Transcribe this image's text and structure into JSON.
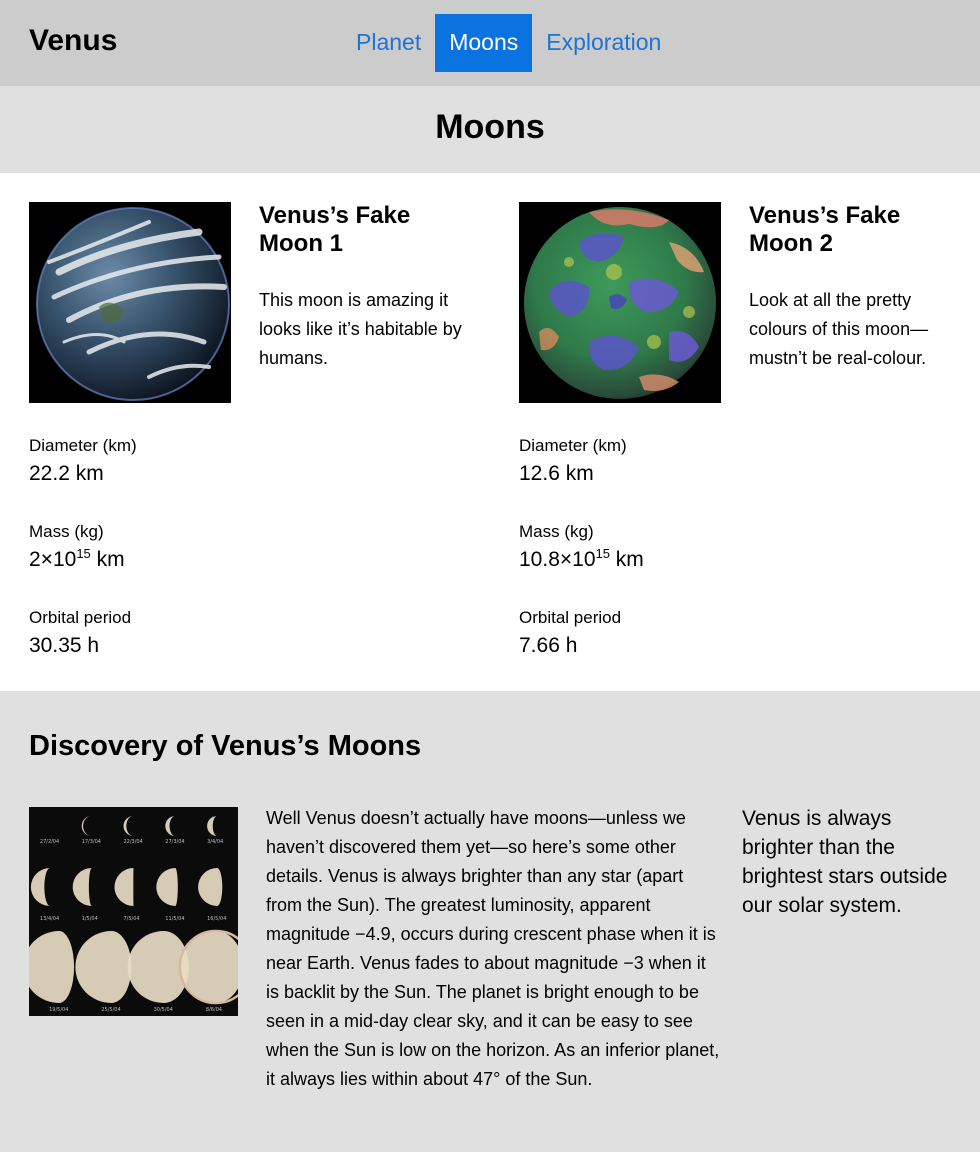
{
  "site": {
    "title": "Venus"
  },
  "nav": {
    "items": [
      {
        "label": "Planet",
        "active": false
      },
      {
        "label": "Moons",
        "active": true
      },
      {
        "label": "Exploration",
        "active": false
      }
    ]
  },
  "page": {
    "title": "Moons"
  },
  "moons": [
    {
      "name": "Venus’s Fake Moon 1",
      "description": "This moon is amazing it looks like it’s habitable by humans.",
      "diameter_label": "Diameter (km)",
      "diameter_value": "22.2 km",
      "mass_label": "Mass (kg)",
      "mass_mantissa": "2×10",
      "mass_exponent": "15",
      "mass_unit": " km",
      "period_label": "Orbital period",
      "period_value": "30.35 h"
    },
    {
      "name": "Venus’s Fake Moon 2",
      "description": "Look at all the pretty colours of this moon—mustn’t be real-colour.",
      "diameter_label": "Diameter (km)",
      "diameter_value": "12.6 km",
      "mass_label": "Mass (kg)",
      "mass_mantissa": "10.8×10",
      "mass_exponent": "15",
      "mass_unit": " km",
      "period_label": "Orbital period",
      "period_value": "7.66 h"
    }
  ],
  "discovery": {
    "title": "Discovery of Venus’s Moons",
    "text": "Well Venus doesn’t actually have moons—unless we haven’t discovered them yet—so here’s some other details. Venus is always brighter than any star (apart from the Sun). The greatest luminosity, apparent magnitude −4.9, occurs during crescent phase when it is near Earth. Venus fades to about magnitude −3 when it is backlit by the Sun. The planet is bright enough to be seen in a mid-day clear sky, and it can be easy to see when the Sun is low on the horizon. As an inferior planet, it always lies within about 47° of the Sun.",
    "aside": "Venus is always brighter than the brightest stars outside our solar system.",
    "phase_dates": [
      "27/2/04",
      "17/3/04",
      "22/3/04",
      "27/3/04",
      "3/4/04",
      "13/4/04",
      "1/5/04",
      "7/5/04",
      "11/5/04",
      "16/5/04",
      "19/5/04",
      "25/5/04",
      "30/5/04",
      "8/6/04"
    ]
  },
  "colors": {
    "topbar": "#cccccc",
    "nav_link": "#1f73d1",
    "nav_active_bg": "#0a73e0",
    "section_grey": "#e0e0e0"
  }
}
